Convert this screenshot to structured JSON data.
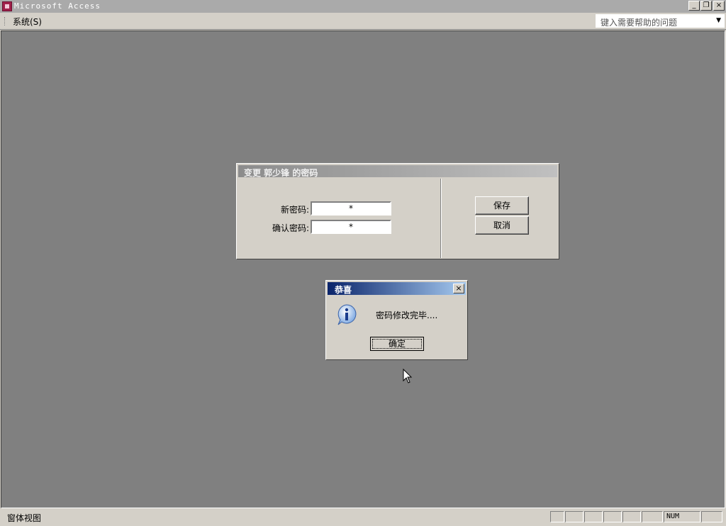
{
  "window": {
    "title": "Microsoft Access",
    "minimize_glyph": "_",
    "restore_glyph": "❐",
    "close_glyph": "×"
  },
  "menubar": {
    "items": [
      {
        "label": "系统(S)"
      }
    ],
    "help_placeholder": "键入需要帮助的问题",
    "help_arrow": "▼"
  },
  "form": {
    "title": "变更 郭少锋 的密码",
    "new_password_label": "新密码:",
    "new_password_value": "*",
    "confirm_password_label": "确认密码:",
    "confirm_password_value": "*",
    "save_label": "保存",
    "cancel_label": "取消"
  },
  "message_box": {
    "title": "恭喜",
    "close_glyph": "×",
    "icon": "info-icon",
    "message": "密码修改完毕....",
    "ok_label": "确定"
  },
  "statusbar": {
    "text": "窗体视图",
    "num_indicator": "NUM"
  },
  "colors": {
    "desktop": "#808080",
    "face": "#d4d0c8",
    "msg_caption_start": "#0a246a",
    "msg_caption_end": "#a6caf0"
  }
}
